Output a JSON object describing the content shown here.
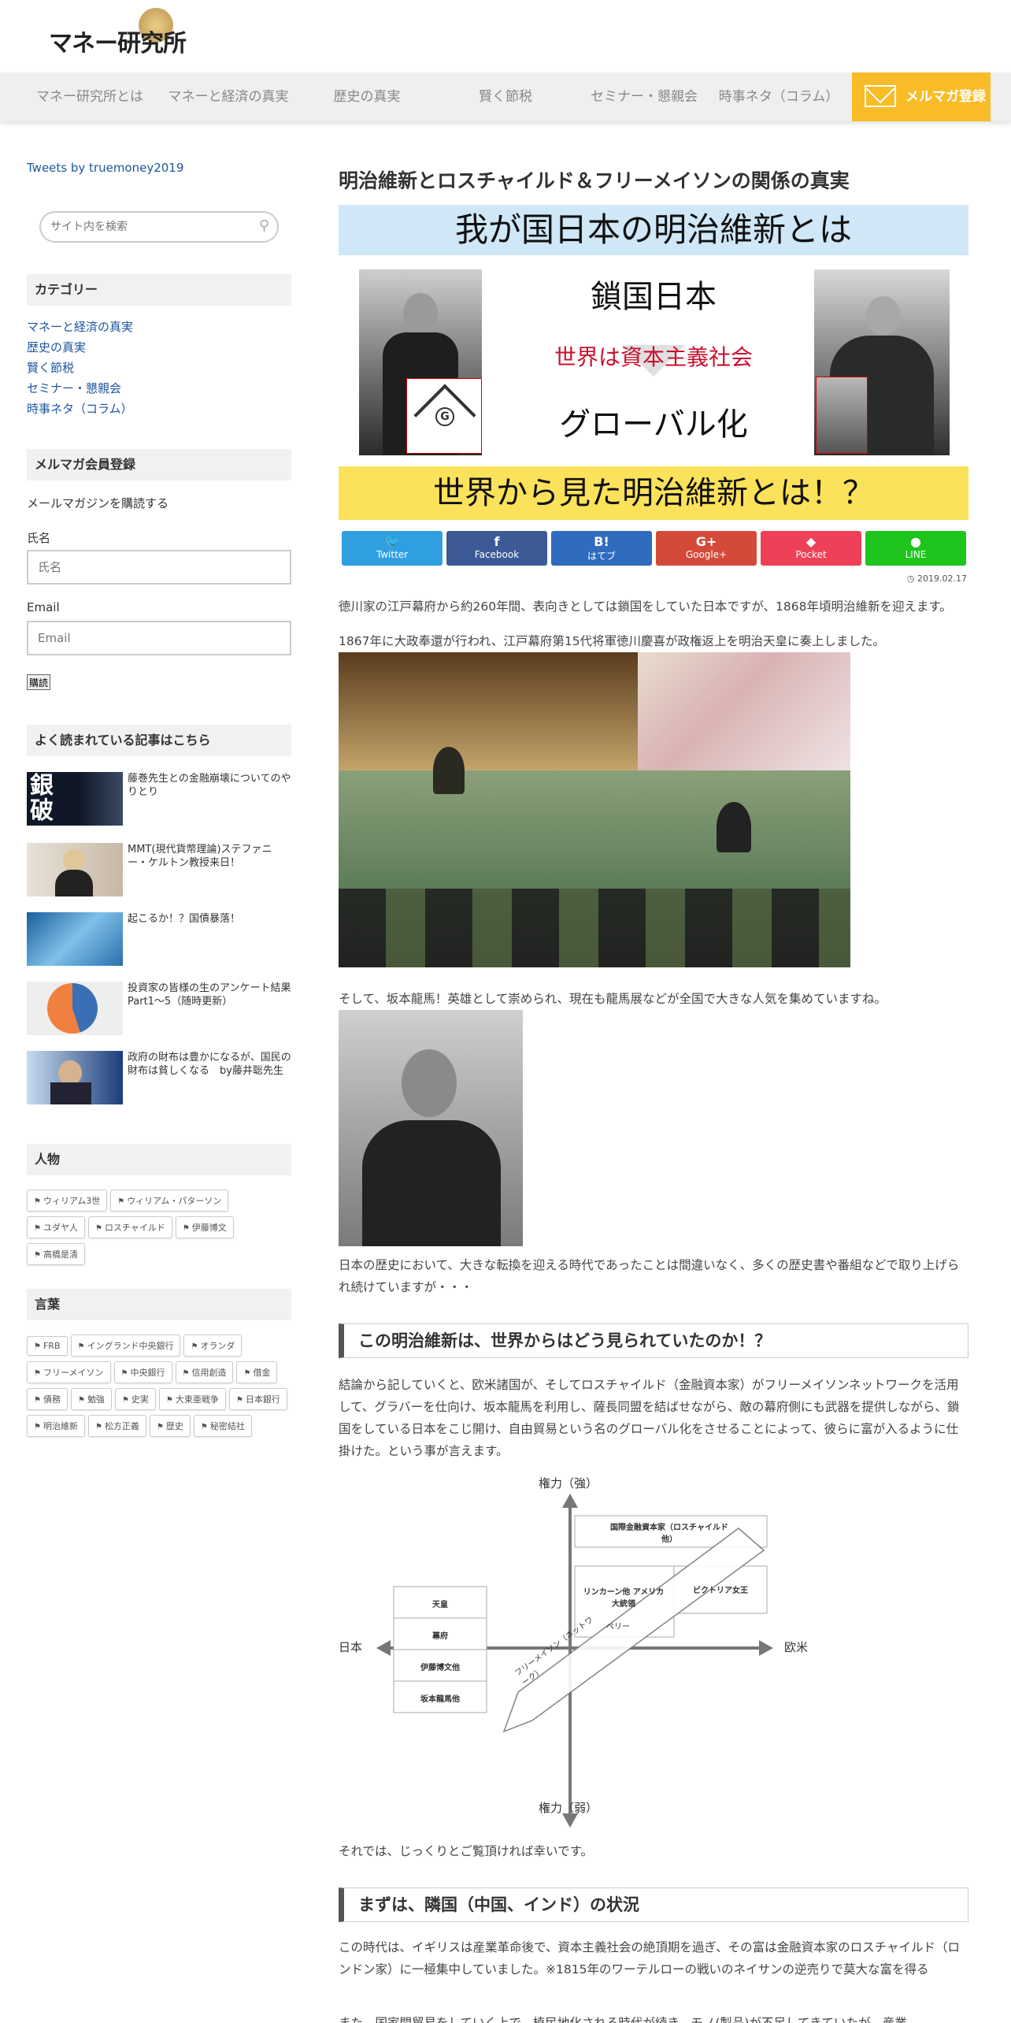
{
  "header": {
    "logo_text": "マネー研究所",
    "nav": [
      "マネー研究所とは",
      "マネーと経済の真実",
      "歴史の真実",
      "賢く節税",
      "セミナー・懇親会",
      "時事ネタ（コラム）"
    ],
    "mail_button": "メルマガ登録"
  },
  "sidebar": {
    "tweets_link": "Tweets by truemoney2019",
    "search_placeholder": "サイト内を検索",
    "category_heading": "カテゴリー",
    "categories": [
      "マネーと経済の真実",
      "歴史の真実",
      "賢く節税",
      "セミナー・懇親会",
      "時事ネタ（コラム）"
    ],
    "newsletter_heading": "メルマガ会員登録",
    "newsletter_desc": "メールマガジンを購読する",
    "name_label": "氏名",
    "name_placeholder": "氏名",
    "email_label": "Email",
    "email_placeholder": "Email",
    "subscribe_button": "購読",
    "popular_heading": "よく読まれている記事はこちら",
    "popular": [
      {
        "title": "藤巻先生との金融崩壊についてのやりとり",
        "thumb": "銀破"
      },
      {
        "title": "MMT(現代貨幣理論)ステファニー・ケルトン教授来日！"
      },
      {
        "title": "起こるか！？国債暴落！"
      },
      {
        "title": "投資家の皆様の生のアンケート結果 Part1～5（随時更新）"
      },
      {
        "title": "政府の財布は豊かになるが、国民の財布は貧しくなる　by藤井聡先生"
      }
    ],
    "people_heading": "人物",
    "people_tags": [
      "ウィリアム3世",
      "ウィリアム・パターソン",
      "ユダヤ人",
      "ロスチャイルド",
      "伊藤博文",
      "高橋是清"
    ],
    "words_heading": "言葉",
    "word_tags": [
      "FRB",
      "イングランド中央銀行",
      "オランダ",
      "フリーメイソン",
      "中央銀行",
      "信用創造",
      "借金",
      "債務",
      "勉強",
      "史実",
      "大東亜戦争",
      "日本銀行",
      "明治維新",
      "松方正義",
      "歴史",
      "秘密結社"
    ]
  },
  "article": {
    "title": "明治維新とロスチャイルド＆フリーメイソンの関係の真実",
    "hero": {
      "top": "我が国日本の明治維新とは",
      "line1": "鎖国日本",
      "middle": "世界は資本主義社会",
      "line2": "グローバル化",
      "bottom": "世界から見た明治維新とは！？"
    },
    "share": [
      {
        "name": "Twitter",
        "icon": "🐦",
        "color": "#2f9fe1"
      },
      {
        "name": "Facebook",
        "icon": "f",
        "color": "#3c5a96"
      },
      {
        "name": "はてブ",
        "icon": "B!",
        "color": "#2f6cbf"
      },
      {
        "name": "Google+",
        "icon": "G+",
        "color": "#d34a3a"
      },
      {
        "name": "Pocket",
        "icon": "◆",
        "color": "#ee4157"
      },
      {
        "name": "LINE",
        "icon": "●",
        "color": "#1dc51d"
      }
    ],
    "date": "2019.02.17",
    "p1": "徳川家の江戸幕府から約260年間、表向きとしては鎖国をしていた日本ですが、1868年頃明治維新を迎えます。",
    "p2": "1867年に大政奉還が行われ、江戸幕府第15代将軍徳川慶喜が政権返上を明治天皇に奏上しました。",
    "p3": "そして、坂本龍馬！英雄として崇められ、現在も龍馬展などが全国で大きな人気を集めていますね。",
    "p4": "日本の歴史において、大きな転換を迎える時代であったことは間違いなく、多くの歴史書や番組などで取り上げられ続けていますが・・・",
    "h2_1": "この明治維新は、世界からはどう見られていたのか！？",
    "p5": "結論から記していくと、欧米諸国が、そしてロスチャイルド（金融資本家）がフリーメイソンネットワークを活用して、グラバーを仕向け、坂本龍馬を利用し、薩長同盟を結ばせながら、敵の幕府側にも武器を提供しながら、鎖国をしている日本をこじ開け、自由貿易という名のグローバル化をさせることによって、彼らに富が入るように仕掛けた。という事が言えます。",
    "diagram": {
      "top": "権力（強）",
      "bottom": "権力（弱）",
      "left": "日本",
      "right": "欧米",
      "box_top_right": "国際金融資本家（ロスチャイルド他）",
      "box_lincoln": "リンカーン他 アメリカ大統領",
      "box_victoria": "ビクトリア女王",
      "box_perry": "ペリー",
      "left_boxes": [
        "天皇",
        "幕府",
        "伊藤博文他",
        "坂本龍馬他"
      ],
      "arrow_label": "フリーメイソン（ネットワーク）"
    },
    "p6": "それでは、じっくりとご覧頂ければ幸いです。",
    "h2_2": "まずは、隣国（中国、インド）の状況",
    "p7": "この時代は、イギリスは産業革命後で、資本主義社会の絶頂期を過ぎ、その富は金融資本家のロスチャイルド（ロンドン家）に一極集中していました。※1815年のワーテルローの戦いのネイサンの逆売りで莫大な富を得る",
    "p8": "また、国家間貿易をしていく上で、植民地化される時代が続き、モノ(製品)が不足してきていたが、産業"
  }
}
